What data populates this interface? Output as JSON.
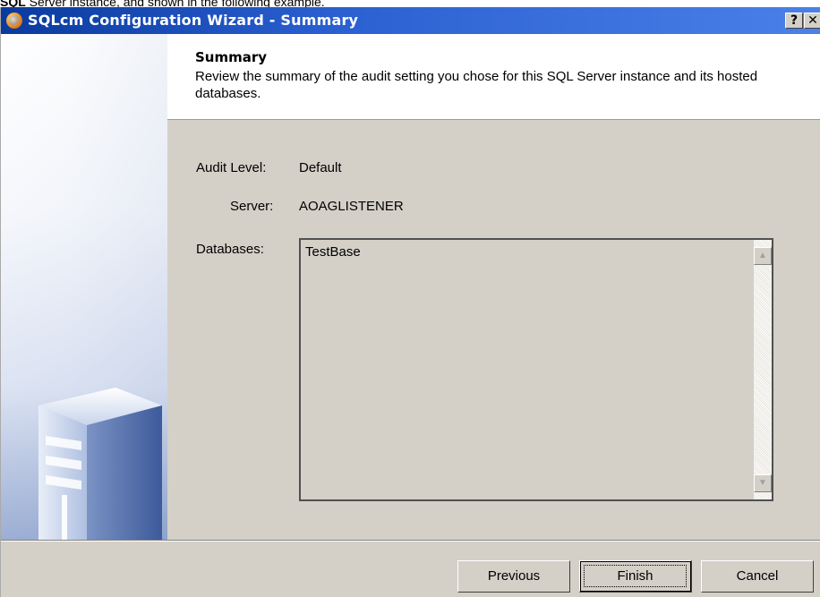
{
  "doc_snippet": {
    "bold": "SQL",
    "rest": "Server instance, and shown in the following example."
  },
  "window": {
    "title": "SQLcm Configuration Wizard - Summary",
    "help_glyph": "?",
    "close_glyph": "✕"
  },
  "header": {
    "title": "Summary",
    "description": "Review the summary of the audit setting you chose for this SQL Server instance and its hosted databases."
  },
  "fields": {
    "audit_level_label": "Audit Level:",
    "audit_level_value": "Default",
    "server_label": "Server:",
    "server_value": "AOAGLISTENER",
    "databases_label": "Databases:"
  },
  "databases": [
    "TestBase"
  ],
  "buttons": {
    "previous": "Previous",
    "finish": "Finish",
    "cancel": "Cancel"
  },
  "colors": {
    "title_bar": "#2a5fd0",
    "dialog_bg": "#d4d0c8",
    "header_bg": "#ffffff"
  },
  "icons": {
    "app": "sqlcm-app-icon",
    "sidebar": "server-tower-icon",
    "scroll_up": "scroll-up-arrow-icon",
    "scroll_down": "scroll-down-arrow-icon"
  }
}
